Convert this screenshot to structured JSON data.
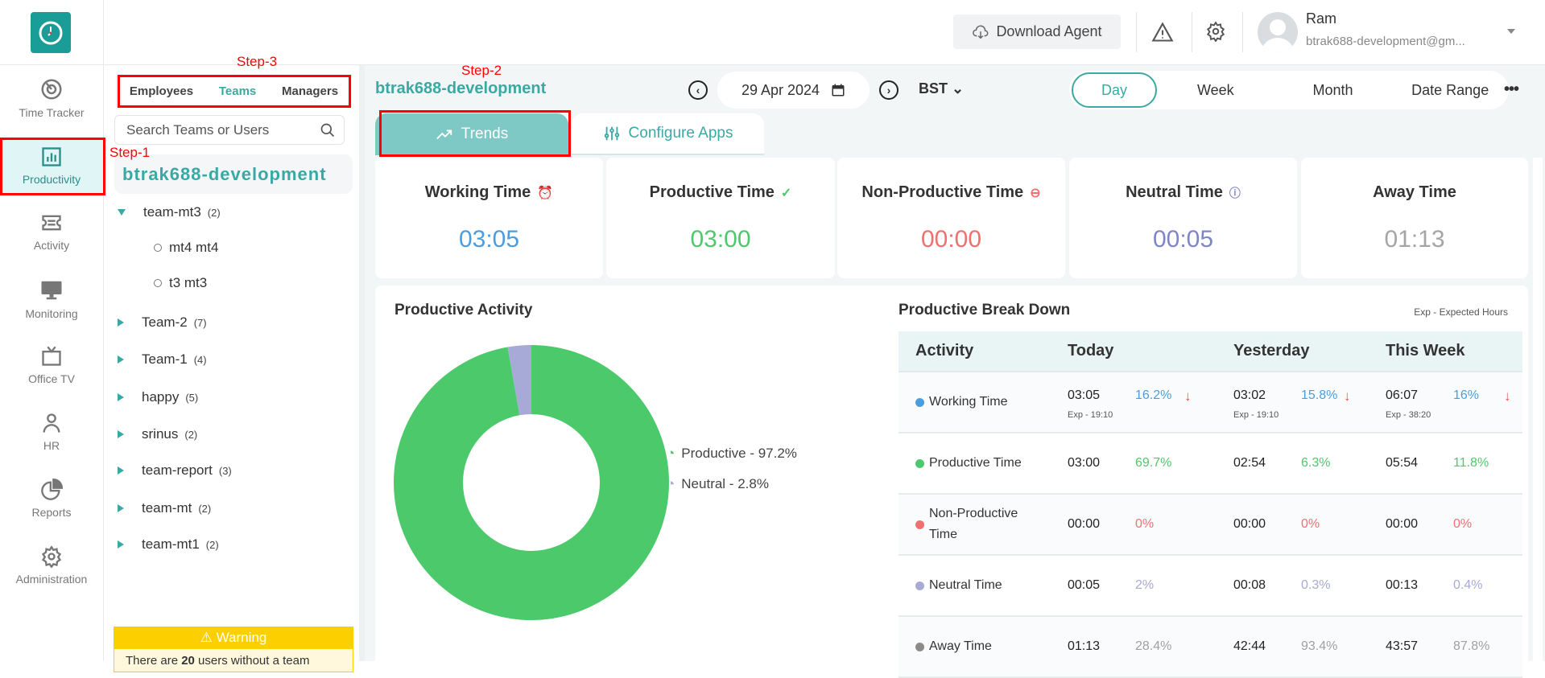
{
  "header": {
    "download_label": "Download Agent",
    "user_name": "Ram",
    "user_email": "btrak688-development@gm..."
  },
  "nav": [
    {
      "label": "Time Tracker"
    },
    {
      "label": "Productivity"
    },
    {
      "label": "Activity"
    },
    {
      "label": "Monitoring"
    },
    {
      "label": "Office TV"
    },
    {
      "label": "HR"
    },
    {
      "label": "Reports"
    },
    {
      "label": "Administration"
    }
  ],
  "team_panel": {
    "tabs": [
      "Employees",
      "Teams",
      "Managers"
    ],
    "search_placeholder": "Search Teams or Users",
    "org": "btrak688-development",
    "teams": [
      {
        "name": "team-mt3",
        "count": "(2)",
        "users": [
          "mt4 mt4",
          "t3 mt3"
        ]
      },
      {
        "name": "Team-2",
        "count": "(7)"
      },
      {
        "name": "Team-1",
        "count": "(4)"
      },
      {
        "name": "happy",
        "count": "(5)"
      },
      {
        "name": "srinus",
        "count": "(2)"
      },
      {
        "name": "team-report",
        "count": "(3)"
      },
      {
        "name": "team-mt",
        "count": "(2)"
      },
      {
        "name": "team-mt1",
        "count": "(2)"
      }
    ],
    "warning_title": "Warning",
    "warning_text_pre": "There are ",
    "warning_count": "20",
    "warning_text_post": " users without a team"
  },
  "main": {
    "org_title": "btrak688-development",
    "date": "29 Apr 2024",
    "timezone": "BST",
    "ranges": [
      "Day",
      "Week",
      "Month",
      "Date Range"
    ],
    "tabs": [
      "Trends",
      "Configure Apps"
    ],
    "cards": [
      {
        "title": "Working Time",
        "value": "03:05",
        "color": "#4a9ee0"
      },
      {
        "title": "Productive Time",
        "value": "03:00",
        "color": "#4cc96b"
      },
      {
        "title": "Non-Productive Time",
        "value": "00:00",
        "color": "#f07070"
      },
      {
        "title": "Neutral Time",
        "value": "00:05",
        "color": "#7f85c9"
      },
      {
        "title": "Away Time",
        "value": "01:13",
        "color": "#a5a5a5"
      }
    ]
  },
  "annotations": {
    "step1": "Step-1",
    "step2": "Step-2",
    "step3": "Step-3"
  },
  "chart_data": {
    "type": "pie",
    "title": "Productive Activity",
    "slices": [
      {
        "label": "Productive - 97.2%",
        "name": "Productive",
        "value": 97.2,
        "color": "#4cc96b"
      },
      {
        "label": "Neutral - 2.8%",
        "name": "Neutral",
        "value": 2.8,
        "color": "#a7a9d6"
      }
    ]
  },
  "breakdown": {
    "title": "Productive Break Down",
    "note": "Exp - Expected Hours",
    "columns": [
      "Activity",
      "Today",
      "Yesterday",
      "This Week"
    ],
    "rows": [
      {
        "activity": "Working Time",
        "color": "#4a9ee0",
        "pct_color": "#4a9ee0",
        "cells": [
          {
            "time": "03:05",
            "pct": "16.2%",
            "arrow": "↓",
            "exp": "Exp - 19:10"
          },
          {
            "time": "03:02",
            "pct": "15.8%",
            "arrow": "↓",
            "exp": "Exp - 19:10"
          },
          {
            "time": "06:07",
            "pct": "16%",
            "arrow": "↓",
            "exp": "Exp - 38:20"
          }
        ]
      },
      {
        "activity": "Productive Time",
        "color": "#4cc96b",
        "pct_color": "#4cc96b",
        "cells": [
          {
            "time": "03:00",
            "pct": "69.7%"
          },
          {
            "time": "02:54",
            "pct": "6.3%"
          },
          {
            "time": "05:54",
            "pct": "11.8%"
          }
        ]
      },
      {
        "activity": "Non-Productive Time",
        "color": "#f07070",
        "pct_color": "#f07070",
        "cells": [
          {
            "time": "00:00",
            "pct": "0%"
          },
          {
            "time": "00:00",
            "pct": "0%"
          },
          {
            "time": "00:00",
            "pct": "0%"
          }
        ]
      },
      {
        "activity": "Neutral Time",
        "color": "#a7a9d6",
        "pct_color": "#a7a9d6",
        "cells": [
          {
            "time": "00:05",
            "pct": "2%"
          },
          {
            "time": "00:08",
            "pct": "0.3%"
          },
          {
            "time": "00:13",
            "pct": "0.4%"
          }
        ]
      },
      {
        "activity": "Away Time",
        "color": "#8f8a8a",
        "pct_color": "#a0a0a0",
        "cells": [
          {
            "time": "01:13",
            "pct": "28.4%"
          },
          {
            "time": "42:44",
            "pct": "93.4%"
          },
          {
            "time": "43:57",
            "pct": "87.8%"
          }
        ]
      }
    ]
  }
}
